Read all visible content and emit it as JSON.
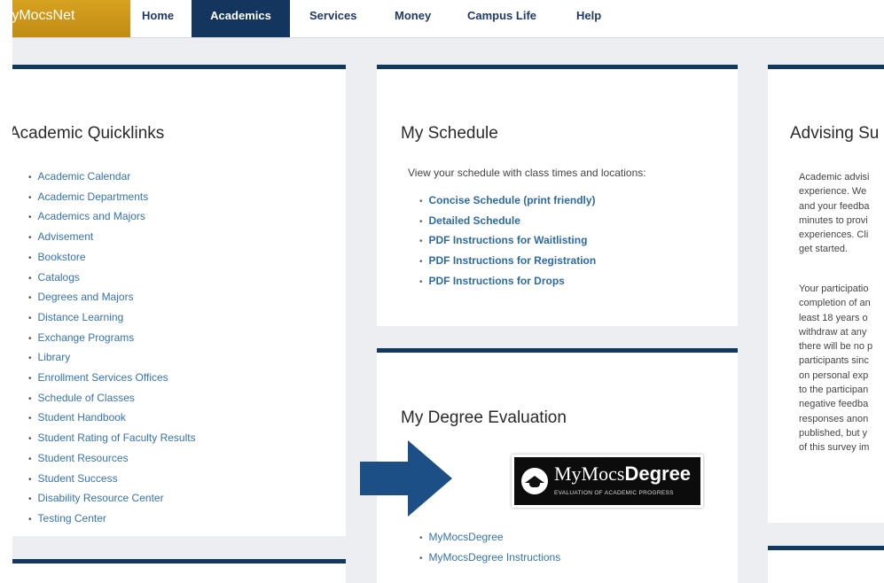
{
  "nav": {
    "brand": "MyMocsNet",
    "items": [
      "Home",
      "Academics",
      "Services",
      "Money",
      "Campus Life",
      "Help"
    ],
    "active": "Academics"
  },
  "quicklinks": {
    "title": "Academic Quicklinks",
    "items": [
      "Academic Calendar",
      "Academic Departments",
      "Academics and Majors",
      "Advisement",
      "Bookstore",
      "Catalogs",
      "Degrees and Majors",
      "Distance Learning",
      "Exchange Programs",
      "Library",
      "Enrollment Services Offices",
      "Schedule of Classes",
      "Student Handbook",
      "Student Rating of Faculty Results",
      "Student Resources",
      "Student Success",
      "Disability Resource Center",
      "Testing Center"
    ]
  },
  "schedule": {
    "title": "My Schedule",
    "intro": "View your schedule with class times and locations:",
    "links": [
      "Concise Schedule (print friendly)",
      "Detailed Schedule",
      "PDF Instructions for Waitlisting",
      "PDF Instructions for Registration",
      "PDF Instructions for Drops"
    ]
  },
  "degree": {
    "title": "My Degree Evaluation",
    "logo_text_light": "MyMocs",
    "logo_text_bold": "Degree",
    "logo_sub": "EVALUATION OF ACADEMIC PROGRESS",
    "links": [
      "MyMocsDegree",
      "MyMocsDegree Instructions"
    ]
  },
  "advising": {
    "title": "Advising Su",
    "para1": [
      "Academic advisi",
      "experience. We",
      "and your feedba",
      "minutes to provi",
      "experiences. Cli",
      "get started."
    ],
    "para2": [
      "Your participatio",
      "completion of an",
      "least 18 years o",
      "withdraw at any",
      "there will be no p",
      "participants sinc",
      "on personal exp",
      "to the participan",
      "negative feedba",
      "responses anon",
      "published, but y",
      "of this survey im"
    ]
  },
  "colors": {
    "navy": "#12385f",
    "gold": "#c99616",
    "link": "#3573b0",
    "arrow": "#1b4f85"
  }
}
